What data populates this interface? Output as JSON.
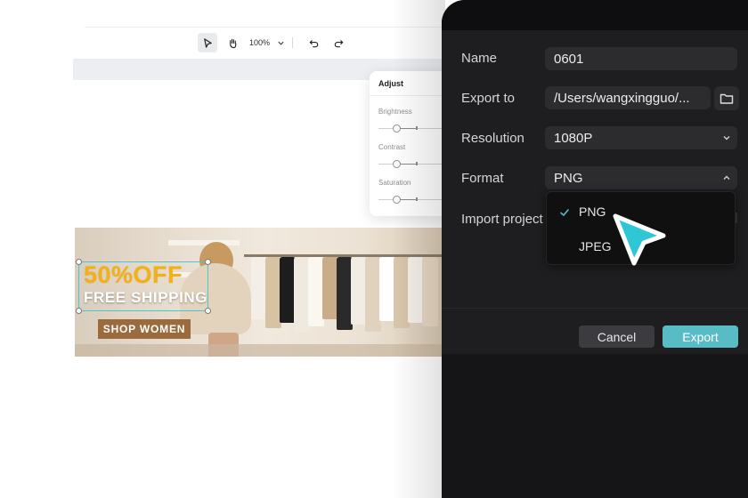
{
  "toolbar": {
    "zoom_level": "100%",
    "icons": [
      "select-arrow-icon",
      "hand-icon",
      "chevron-down-icon",
      "undo-icon",
      "redo-icon"
    ]
  },
  "adjust_panel": {
    "title": "Adjust",
    "sliders": [
      {
        "label": "Brightness",
        "value": 0.2
      },
      {
        "label": "Contrast",
        "value": 0.2
      },
      {
        "label": "Saturation",
        "value": 0.2
      }
    ]
  },
  "banner": {
    "headline": "50%OFF",
    "subline": "FREE SHIPPING",
    "brand": "SHOP WOMEN"
  },
  "export_dialog": {
    "name_label": "Name",
    "name_value": "0601",
    "export_to_label": "Export to",
    "export_to_value": "/Users/wangxingguo/...",
    "resolution_label": "Resolution",
    "resolution_value": "1080P",
    "format_label": "Format",
    "format_value": "PNG",
    "import_project_label": "Import project",
    "format_options": [
      {
        "label": "PNG",
        "selected": true
      },
      {
        "label": "JPEG",
        "selected": false
      }
    ],
    "cancel_label": "Cancel",
    "export_label": "Export"
  },
  "colors": {
    "accent": "#58bcc6",
    "dialog_bg": "#1e1e20",
    "promo_yellow": "#f5b014",
    "selection": "#4cc4d1"
  }
}
